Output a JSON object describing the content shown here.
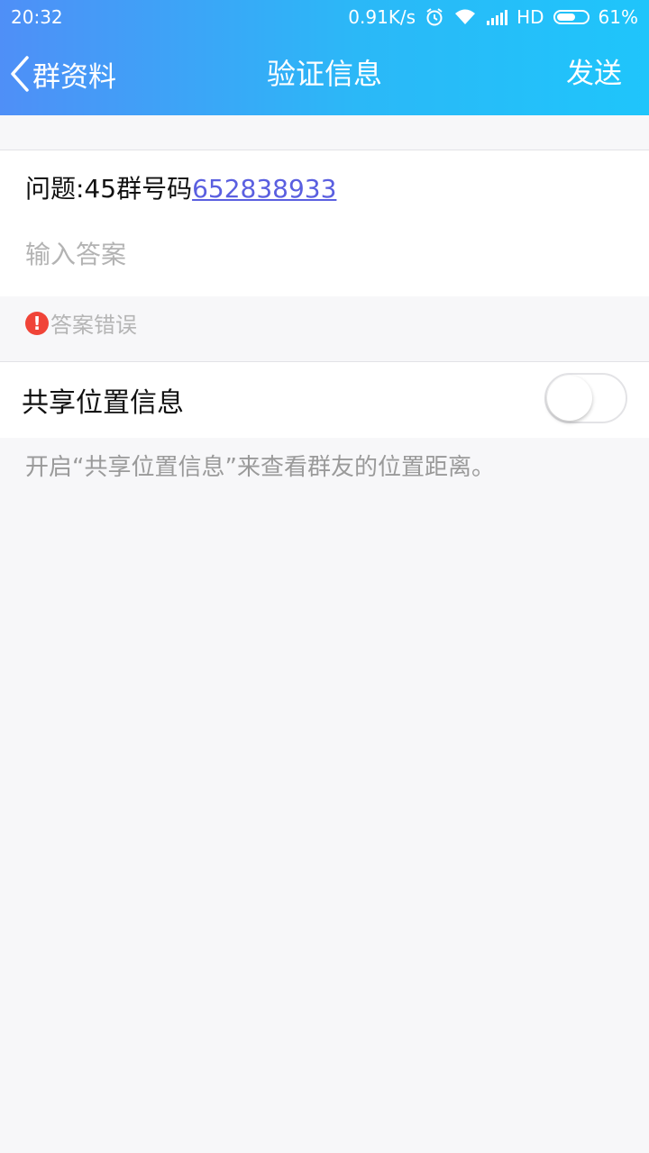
{
  "status_bar": {
    "time": "20:32",
    "network_speed": "0.91K/s",
    "network_type": "HD",
    "battery": "61%",
    "battery_level": 0.61,
    "icons": [
      "alarm-icon",
      "wifi-icon",
      "signal-icon",
      "battery-icon"
    ]
  },
  "nav": {
    "back_label": "群资料",
    "title": "验证信息",
    "send_label": "发送"
  },
  "form": {
    "question_prefix": "问题:45群号码",
    "question_link": "652838933",
    "answer_placeholder": "输入答案",
    "answer_value": "",
    "error_text": "答案错误"
  },
  "location": {
    "label": "共享位置信息",
    "toggle_on": false,
    "hint": "开启“共享位置信息”来查看群友的位置距离。"
  },
  "colors": {
    "header_start": "#4f8ff7",
    "header_end": "#1fc5fb",
    "link": "#5a5fe0",
    "error": "#f04438"
  }
}
